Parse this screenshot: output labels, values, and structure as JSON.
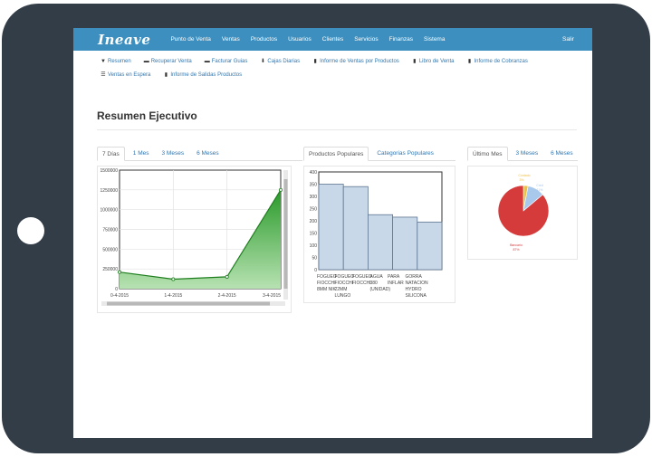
{
  "navbar": {
    "brand": "Ineave",
    "items": [
      "Punto de Venta",
      "Ventas",
      "Productos",
      "Usuarios",
      "Clientes",
      "Servicios",
      "Finanzas",
      "Sistema"
    ],
    "logout": "Salir",
    "color": "#3c8fbf"
  },
  "subnav": [
    {
      "label": "Resumen",
      "icon": "filter-icon"
    },
    {
      "label": "Recuperar Venta",
      "icon": "folder-open-icon"
    },
    {
      "label": "Facturar Guias",
      "icon": "folder-open-icon"
    },
    {
      "label": "Cajas Diarias",
      "icon": "download-icon"
    },
    {
      "label": "Informe de Ventas por Productos",
      "icon": "file-icon"
    },
    {
      "label": "Libro de Venta",
      "icon": "file-icon"
    },
    {
      "label": "Informe de Cobranzas",
      "icon": "file-icon"
    },
    {
      "label": "Ventas en Espera",
      "icon": "list-icon"
    },
    {
      "label": "Informe de Salidas Productos",
      "icon": "file-icon"
    }
  ],
  "page_title": "Resumen Ejecutivo",
  "sales_tabs": [
    "7 Días",
    "1 Mes",
    "3 Meses",
    "6 Meses"
  ],
  "products_tabs": [
    "Productos Populares",
    "Categorias Populares"
  ],
  "month_tabs": [
    "Último Mes",
    "3 Meses",
    "6 Meses"
  ],
  "chart_data": [
    {
      "type": "area",
      "x": [
        "0-4-2015",
        "1-4-2015",
        "2-4-2015",
        "3-4-2015"
      ],
      "y": [
        210000,
        120000,
        150000,
        1250000
      ],
      "ylim": [
        0,
        1500000
      ],
      "yticks": [
        "1500000",
        "1250000",
        "1000000",
        "750000",
        "500000",
        "250000",
        "0"
      ],
      "xtick_labels": [
        "0-4-2015",
        "1-4-2015",
        "2-4-2015",
        "3-4-2015"
      ],
      "grid": true,
      "color": "#3aa63a"
    },
    {
      "type": "bar",
      "categories": [
        [
          "FOGUEO",
          "FIOCCHI",
          "8MM NIK"
        ],
        [
          "FOGUEO",
          "FIOCCHI",
          "22MM",
          "LUNGO"
        ],
        [
          "FOGUEO",
          "FIOCCHI",
          ""
        ],
        [
          "AGUA",
          "380",
          "(UNIDAD)"
        ],
        [
          "PARA",
          "INFLAR",
          ""
        ],
        [
          "GORRA",
          "NATACION",
          "HYDRO",
          "SILICONA"
        ]
      ],
      "values": [
        350,
        340,
        225,
        215,
        195
      ],
      "ylim": [
        0,
        400
      ],
      "yticks": [
        "400",
        "350",
        "300",
        "250",
        "200",
        "150",
        "100",
        "50",
        "0"
      ],
      "color": "#c8d8e8"
    },
    {
      "type": "pie",
      "labels": [
        "Contado",
        "Cred",
        "Bancario"
      ],
      "values": [
        3,
        11,
        87
      ],
      "value_labels": [
        "3%",
        "11%",
        "87%"
      ],
      "colors": [
        "#f0c040",
        "#a8c8ec",
        "#d63b3b"
      ]
    }
  ]
}
